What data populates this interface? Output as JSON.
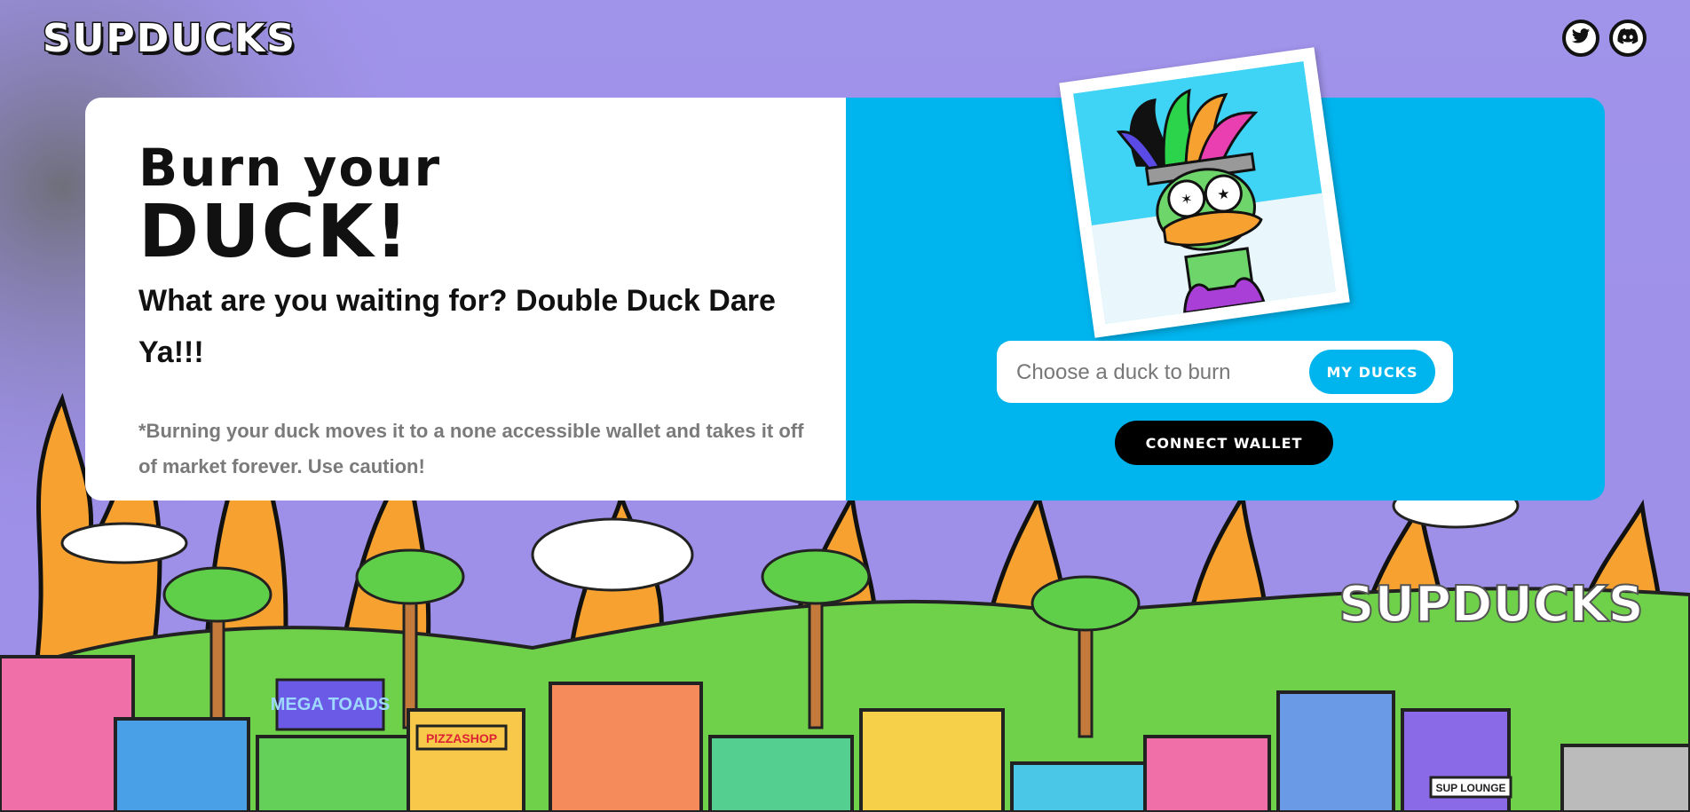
{
  "brand": {
    "logo_text": "SUPDUCKS"
  },
  "social": [
    {
      "name": "twitter",
      "icon": "twitter-icon"
    },
    {
      "name": "discord",
      "icon": "discord-icon"
    }
  ],
  "hero": {
    "title_line1": "Burn your",
    "title_line2": "DUCK!",
    "subtitle": "What are you waiting for? Double Duck Dare Ya!!!",
    "note": "*Burning your duck moves it to a none accessible wallet and takes it off of market forever. Use caution!"
  },
  "burn": {
    "placeholder": "Choose a duck to burn",
    "my_ducks_label": "MY DUCKS",
    "connect_label": "CONNECT WALLET"
  },
  "background": {
    "signage": [
      "MEGA TOADS",
      "PIZZASHOP",
      "SUPDUCKS",
      "SUP LOUNGE"
    ]
  },
  "colors": {
    "accent": "#00b4ed",
    "sky": "#9a8fe6",
    "flame": "#f7a230"
  }
}
